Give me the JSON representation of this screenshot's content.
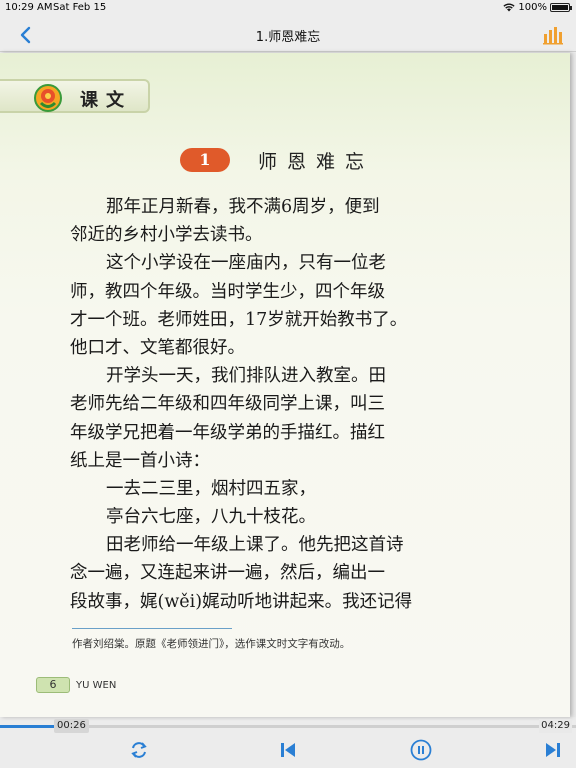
{
  "status_bar": {
    "time": "10:29 AM",
    "date": "Sat Feb 15",
    "battery": "100%",
    "battery_level": 1.0,
    "wifi_icon": "wifi-icon"
  },
  "nav": {
    "title": "1.师恩难忘",
    "back_icon": "chevron-left-icon",
    "stats_icon": "bar-chart-icon",
    "accent_color": "#2a7fd4",
    "stats_color": "#f0a030"
  },
  "page": {
    "section_label": "课文",
    "lesson_number": "1",
    "lesson_title": "师恩难忘",
    "lines": [
      {
        "text": "那年正月新春，我不满6周岁，便到",
        "indent": true
      },
      {
        "text": "邻近的乡村小学去读书。",
        "indent": false
      },
      {
        "text": "这个小学设在一座庙内，只有一位老",
        "indent": true
      },
      {
        "text": "师，教四个年级。当时学生少，四个年级",
        "indent": false
      },
      {
        "text": "才一个班。老师姓田，17岁就开始教书了。",
        "indent": false
      },
      {
        "text": "他口才、文笔都很好。",
        "indent": false
      },
      {
        "text": "开学头一天，我们排队进入教室。田",
        "indent": true
      },
      {
        "text": "老师先给二年级和四年级同学上课，叫三",
        "indent": false
      },
      {
        "text": "年级学兄把着一年级学弟的手描红。描红",
        "indent": false
      },
      {
        "text": "纸上是一首小诗：",
        "indent": false
      },
      {
        "text": "一去二三里，烟村四五家，",
        "indent": true
      },
      {
        "text": "亭台六七座，八九十枝花。",
        "indent": true
      },
      {
        "text": "田老师给一年级上课了。他先把这首诗",
        "indent": true
      },
      {
        "text": "念一遍，又连起来讲一遍，然后，编出一",
        "indent": false
      },
      {
        "text": "段故事，娓(wěi)娓动听地讲起来。我还记得",
        "indent": false
      }
    ],
    "footnote": "作者刘绍棠。原题《老师领进门》，选作课文时文字有改动。",
    "page_number": "6",
    "brand": "YU WEN"
  },
  "player": {
    "current_time": "00:26",
    "total_time": "04:29",
    "progress": 0.097,
    "repeat_icon": "repeat-icon",
    "prev_icon": "skip-previous-icon",
    "pause_icon": "pause-icon",
    "next_icon": "skip-next-icon"
  }
}
